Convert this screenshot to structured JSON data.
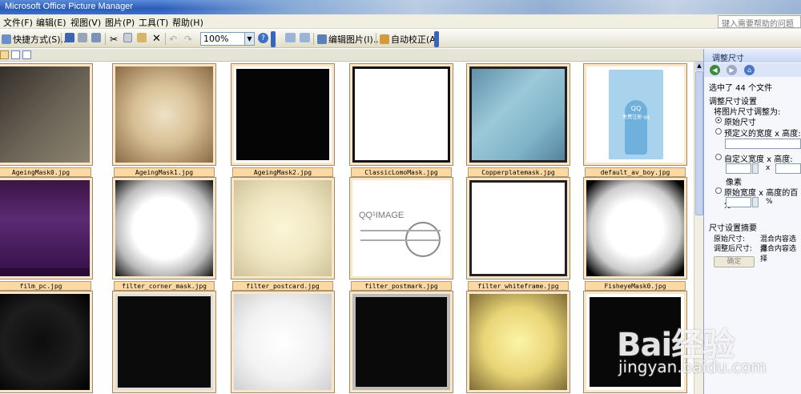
{
  "window": {
    "title": "Microsoft Office Picture Manager"
  },
  "menu": {
    "items": [
      "文件(F)",
      "编辑(E)",
      "视图(V)",
      "图片(P)",
      "工具(T)",
      "帮助(H)"
    ]
  },
  "help_box": {
    "placeholder": "键入需要帮助的问题"
  },
  "toolbar": {
    "shortcut_label": "快捷方式(S)...",
    "zoom_value": "100%",
    "edit_pictures_label": "编辑图片(I)...",
    "auto_correct_label": "自动校正(A)"
  },
  "thumbnails": [
    {
      "file": "AgeingMask0.jpg",
      "style": "ageing0"
    },
    {
      "file": "AgeingMask1.jpg",
      "style": "ageing1"
    },
    {
      "file": "AgeingMask2.jpg",
      "style": "ageing2"
    },
    {
      "file": "ClassicLomoMask.jpg",
      "style": "lomo"
    },
    {
      "file": "Copperplatemask.jpg",
      "style": "copper"
    },
    {
      "file": "default_av_boy.jpg",
      "style": "avatar"
    },
    {
      "file": "film_pc.jpg",
      "style": "film"
    },
    {
      "file": "filter_corner_mask.jpg",
      "style": "corner"
    },
    {
      "file": "filter_postcard.jpg",
      "style": "postcard"
    },
    {
      "file": "filter_postmark.jpg",
      "style": "postmark"
    },
    {
      "file": "filter_whiteframe.jpg",
      "style": "whiteframe"
    },
    {
      "file": "FisheyeMask0.jpg",
      "style": "fisheye"
    },
    {
      "file": "",
      "style": "darkvig"
    },
    {
      "file": "",
      "style": "blackgrunge"
    },
    {
      "file": "",
      "style": "whiteglow"
    },
    {
      "file": "",
      "style": "blackround"
    },
    {
      "file": "",
      "style": "yellowglow"
    },
    {
      "file": "",
      "style": "blackedge"
    }
  ],
  "postmark_text": "QQ¹IMAGE",
  "avatar_text": {
    "line1": "QQ",
    "line2": "免费注册 qq"
  },
  "task_pane": {
    "title": "调整尺寸",
    "selected_count": "选中了 44 个文件",
    "settings_heading": "调整尺寸设置",
    "resize_to_label": "将图片尺寸调整为:",
    "options": [
      "原始尺寸",
      "预定义的宽度 x 高度:",
      "自定义宽度 x 高度:",
      "原始宽度 x 高度的百分"
    ],
    "x_label": "x",
    "pixels_label": "像素",
    "percent_label": "%",
    "summary_heading": "尺寸设置摘要",
    "original_size_label": "原始尺寸:",
    "original_size_value": "混合内容选择",
    "resized_label": "调整后尺寸:",
    "resized_value": "混合内容选择",
    "ok_label": "确定"
  },
  "watermark": {
    "logo": "Bai经验",
    "url": "jingyan.baidu.com"
  }
}
